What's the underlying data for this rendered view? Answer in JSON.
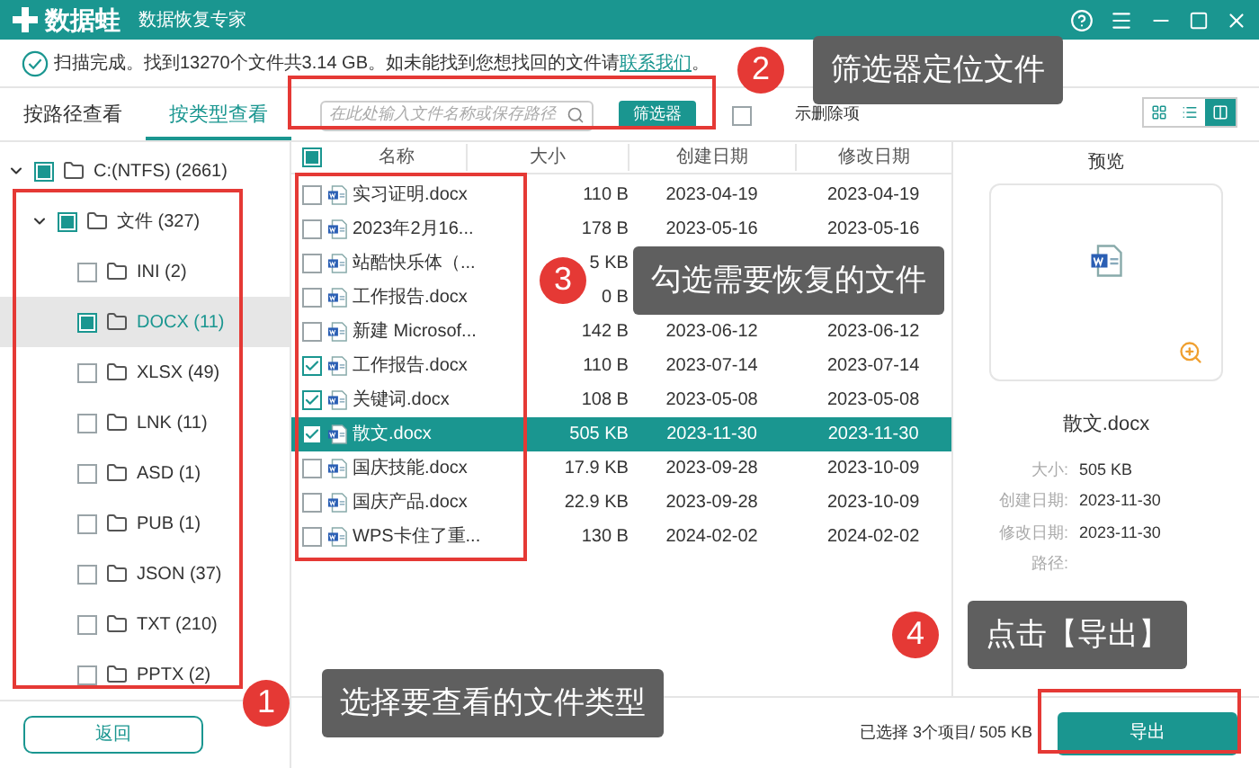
{
  "app": {
    "logo": "数据蛙",
    "subtitle": "数据恢复专家"
  },
  "status": {
    "text": "扫描完成。找到13270个文件共3.14 GB。如未能找到您想找回的文件请",
    "link": "联系我们",
    "end": "。"
  },
  "tabs": [
    {
      "label": "按路径查看",
      "selected": false
    },
    {
      "label": "按类型查看",
      "selected": true
    }
  ],
  "search": {
    "placeholder": "在此处输入文件名称或保存路径",
    "button": "筛选器",
    "deleted_toggle": {
      "label": "示删除项",
      "checked": false
    }
  },
  "views": [
    {
      "kind": "grid",
      "selected": false
    },
    {
      "kind": "list",
      "selected": false
    },
    {
      "kind": "preview",
      "selected": true
    }
  ],
  "tree": [
    {
      "label": "C:(NTFS) (2661)",
      "checked": true,
      "expanded": true,
      "selected": false,
      "children": [
        {
          "label": "文件 (327)",
          "checked": true,
          "expanded": true,
          "selected": false,
          "children": [
            {
              "label": "INI (2)",
              "checked": false,
              "selected": false
            },
            {
              "label": "DOCX (11)",
              "checked": true,
              "selected": true
            },
            {
              "label": "XLSX (49)",
              "checked": false,
              "selected": false
            },
            {
              "label": "LNK (11)",
              "checked": false,
              "selected": false
            },
            {
              "label": "ASD (1)",
              "checked": false,
              "selected": false
            },
            {
              "label": "PUB (1)",
              "checked": false,
              "selected": false
            },
            {
              "label": "JSON (37)",
              "checked": false,
              "selected": false
            },
            {
              "label": "TXT (210)",
              "checked": false,
              "selected": false
            },
            {
              "label": "PPTX (2)",
              "checked": false,
              "selected": false
            }
          ]
        }
      ]
    }
  ],
  "back_button": "返回",
  "table": {
    "header_checked": true,
    "columns": [
      "名称",
      "大小",
      "创建日期",
      "修改日期"
    ],
    "rows": [
      {
        "name": "实习证明.docx",
        "size": "110 B",
        "created": "2023-04-19",
        "modified": "2023-04-19",
        "checked": false,
        "selected": false
      },
      {
        "name": "2023年2月16...",
        "size": "178 B",
        "created": "2023-05-16",
        "modified": "2023-05-16",
        "checked": false,
        "selected": false
      },
      {
        "name": "站酷快乐体（...",
        "size": "5 KB",
        "checked": false,
        "selected": false
      },
      {
        "name": "工作报告.docx",
        "size": "0 B",
        "checked": false,
        "selected": false
      },
      {
        "name": "新建 Microsof...",
        "size": "142 B",
        "created": "2023-06-12",
        "modified": "2023-06-12",
        "checked": false,
        "selected": false
      },
      {
        "name": "工作报告.docx",
        "size": "110 B",
        "created": "2023-07-14",
        "modified": "2023-07-14",
        "checked": true,
        "selected": false
      },
      {
        "name": "关键词.docx",
        "size": "108 B",
        "created": "2023-05-08",
        "modified": "2023-05-08",
        "checked": true,
        "selected": false
      },
      {
        "name": "散文.docx",
        "size": "505 KB",
        "created": "2023-11-30",
        "modified": "2023-11-30",
        "checked": true,
        "selected": true
      },
      {
        "name": "国庆技能.docx",
        "size": "17.9 KB",
        "created": "2023-09-28",
        "modified": "2023-10-09",
        "checked": false,
        "selected": false
      },
      {
        "name": "国庆产品.docx",
        "size": "22.9 KB",
        "created": "2023-09-28",
        "modified": "2023-10-09",
        "checked": false,
        "selected": false
      },
      {
        "name": "WPS卡住了重...",
        "size": "130 B",
        "created": "2024-02-02",
        "modified": "2024-02-02",
        "checked": false,
        "selected": false
      }
    ]
  },
  "preview": {
    "title": "预览",
    "file_name": "散文.docx",
    "fields": [
      {
        "label": "大小:",
        "value": "505 KB"
      },
      {
        "label": "创建日期:",
        "value": "2023-11-30"
      },
      {
        "label": "修改日期:",
        "value": "2023-11-30"
      },
      {
        "label": "路径:"
      }
    ]
  },
  "footer": {
    "summary": "已选择 3个项目/ 505 KB",
    "export_button": "导出"
  },
  "steps": [
    {
      "number": "1",
      "text": "选择要查看的文件类型"
    },
    {
      "number": "2",
      "text": "筛选器定位文件"
    },
    {
      "number": "3",
      "text": "勾选需要恢复的文件"
    },
    {
      "number": "4",
      "text": "点击【导出】"
    }
  ]
}
